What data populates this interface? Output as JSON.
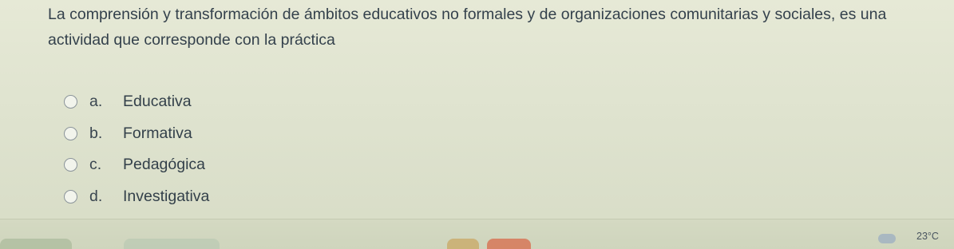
{
  "question": {
    "text": "La comprensión y transformación de ámbitos educativos no formales y de organizaciones comunitarias y sociales, es una actividad que corresponde con la práctica"
  },
  "options": [
    {
      "letter": "a.",
      "label": "Educativa"
    },
    {
      "letter": "b.",
      "label": "Formativa"
    },
    {
      "letter": "c.",
      "label": "Pedagógica"
    },
    {
      "letter": "d.",
      "label": "Investigativa"
    }
  ],
  "taskbar": {
    "temperature": "23°C",
    "weather_icon": "cloud-icon"
  }
}
